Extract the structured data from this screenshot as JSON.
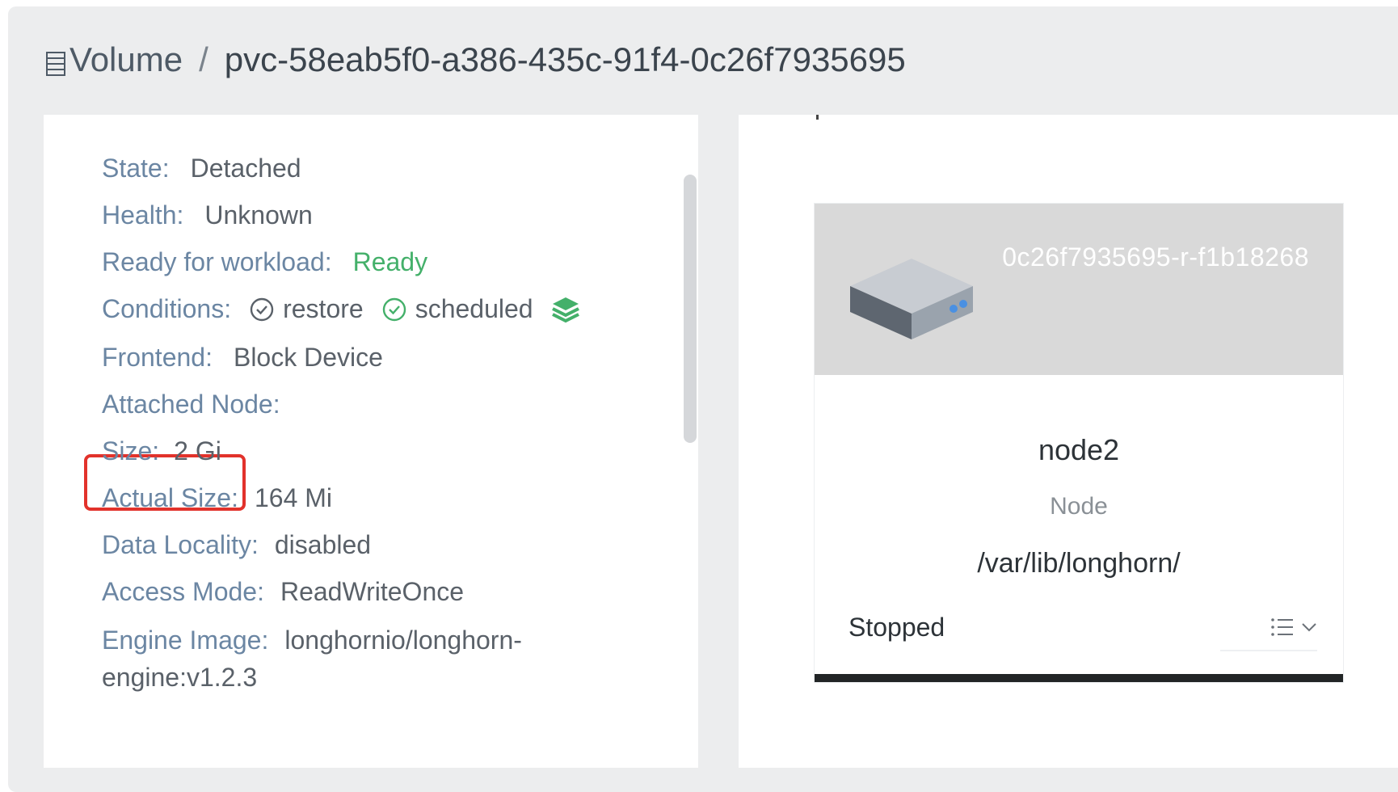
{
  "header": {
    "breadcrumb_root": "Volume",
    "separator": "/",
    "volume_name": "pvc-58eab5f0-a386-435c-91f4-0c26f7935695"
  },
  "details": {
    "state": {
      "label": "State:",
      "value": "Detached"
    },
    "health": {
      "label": "Health:",
      "value": "Unknown"
    },
    "ready": {
      "label": "Ready for workload:",
      "value": "Ready"
    },
    "conditions": {
      "label": "Conditions:",
      "items": [
        {
          "name": "restore",
          "icon": "check-circle-icon",
          "color": "#5a6169"
        },
        {
          "name": "scheduled",
          "icon": "check-circle-icon",
          "color": "#44b06a"
        }
      ]
    },
    "frontend": {
      "label": "Frontend:",
      "value": "Block Device"
    },
    "attached_node": {
      "label": "Attached Node:",
      "value": ""
    },
    "size": {
      "label": "Size:",
      "value": "2 Gi"
    },
    "actual_size": {
      "label": "Actual Size:",
      "value": "164 Mi"
    },
    "data_locality": {
      "label": "Data Locality:",
      "value": "disabled"
    },
    "access_mode": {
      "label": "Access Mode:",
      "value": "ReadWriteOnce"
    },
    "engine_image": {
      "label": "Engine Image:",
      "value_line1": "longhornio/longhorn-",
      "value_line2": "engine:v1.2.3"
    }
  },
  "replica": {
    "name": "0c26f7935695-r-f1b18268",
    "node": "node2",
    "node_label": "Node",
    "path": "/var/lib/longhorn/",
    "status": "Stopped"
  },
  "colors": {
    "label": "#6b86a3",
    "ready": "#44b06a",
    "highlight": "#e2322b"
  }
}
